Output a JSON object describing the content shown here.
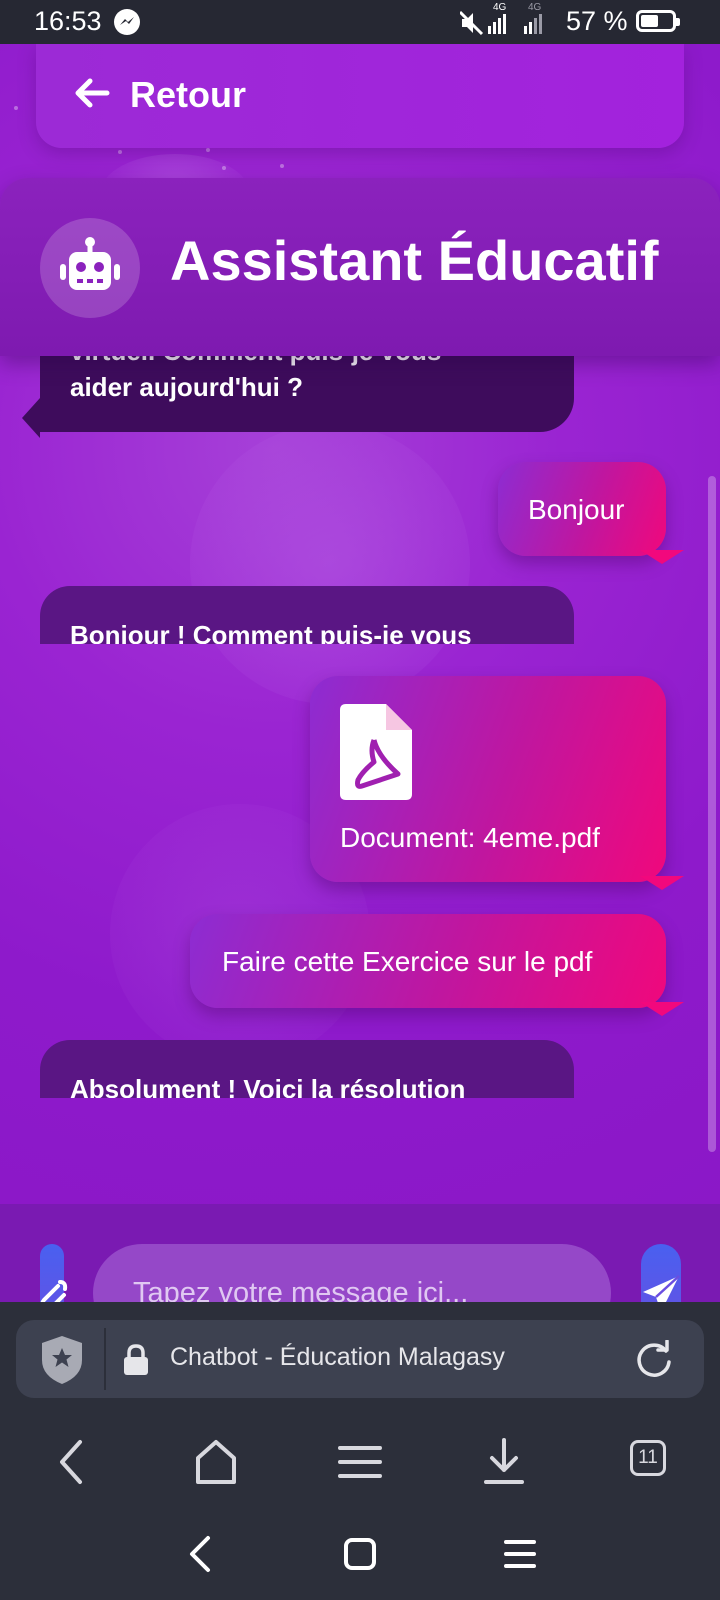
{
  "status_bar": {
    "time": "16:53",
    "network_1": "4G",
    "network_2": "4G",
    "battery_percent": "57 %",
    "battery_level": 0.57,
    "icons": [
      "messenger-icon",
      "mute-icon",
      "signal-icon",
      "signal-icon",
      "battery-icon"
    ]
  },
  "app": {
    "back_label": "Retour",
    "header_title": "Assistant Éducatif",
    "messages": [
      {
        "from": "bot",
        "text_lines": [
          "virtuel. Comment puis-je vous",
          "aider aujourd'hui ?"
        ]
      },
      {
        "from": "user",
        "text": "Bonjour"
      },
      {
        "from": "bot",
        "text_lines": [
          "Bonjour ! Comment puis-je vous"
        ]
      },
      {
        "from": "user",
        "type": "file",
        "icon": "pdf-file-icon",
        "text": "Document: 4eme.pdf"
      },
      {
        "from": "user",
        "text": "Faire cette Exercice sur le pdf"
      },
      {
        "from": "bot",
        "text_lines": [
          "Absolument ! Voici la résolution"
        ]
      }
    ],
    "input": {
      "placeholder": "Tapez votre message ici...",
      "value": ""
    },
    "colors": {
      "bot_bubble": "#5a1684",
      "user_bubble_start": "#8d2cd2",
      "user_bubble_end": "#f0087c",
      "background": "#9a24d2"
    }
  },
  "browser": {
    "page_title": "Chatbot - Éducation Malagasy",
    "tab_count": "11"
  }
}
